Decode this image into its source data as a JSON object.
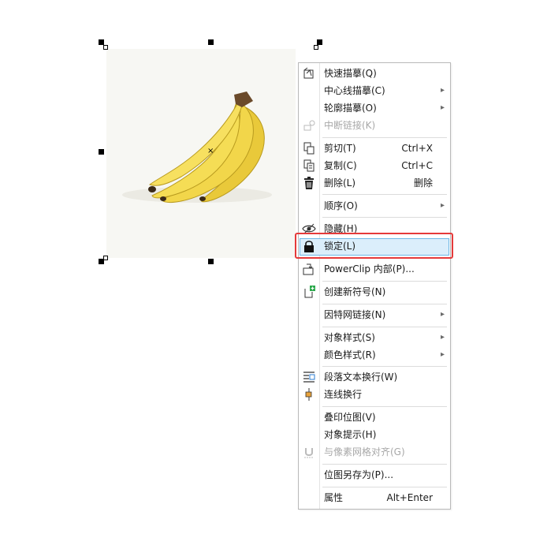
{
  "menu": {
    "items": [
      {
        "label": "快速描摹(Q)",
        "icon": "trace-icon"
      },
      {
        "label": "中心线描摹(C)",
        "submenu": true
      },
      {
        "label": "轮廓描摹(O)",
        "submenu": true
      },
      {
        "label": "中断链接(K)",
        "disabled": true,
        "icon": "break-link-icon"
      },
      {
        "label": "剪切(T)",
        "shortcut": "Ctrl+X",
        "icon": "cut-icon"
      },
      {
        "label": "复制(C)",
        "shortcut": "Ctrl+C",
        "icon": "copy-icon"
      },
      {
        "label": "删除(L)",
        "shortcut": "删除",
        "icon": "trash-icon"
      },
      {
        "label": "顺序(O)",
        "submenu": true
      },
      {
        "label": "隐藏(H)",
        "icon": "eye-icon"
      },
      {
        "label": "锁定(L)",
        "icon": "lock-icon",
        "selected": true
      },
      {
        "label": "PowerClip 内部(P)...",
        "icon": "powerclip-icon"
      },
      {
        "label": "创建新符号(N)",
        "icon": "new-symbol-icon"
      },
      {
        "label": "因特网链接(N)",
        "submenu": true
      },
      {
        "label": "对象样式(S)",
        "submenu": true
      },
      {
        "label": "颜色样式(R)",
        "submenu": true
      },
      {
        "label": "段落文本换行(W)",
        "icon": "text-wrap-icon"
      },
      {
        "label": "连线换行",
        "icon": "connector-wrap-icon"
      },
      {
        "label": "叠印位图(V)"
      },
      {
        "label": "对象提示(H)"
      },
      {
        "label": "与像素网格对齐(G)",
        "disabled": true,
        "icon": "magnet-icon"
      },
      {
        "label": "位图另存为(P)..."
      },
      {
        "label": "属性",
        "shortcut": "Alt+Enter"
      }
    ]
  },
  "colors": {
    "selection_bg": "#dbeefb",
    "selection_border": "#6fb8e6",
    "highlight_annotation": "#e53a3a",
    "banana": "#f2d64a"
  }
}
